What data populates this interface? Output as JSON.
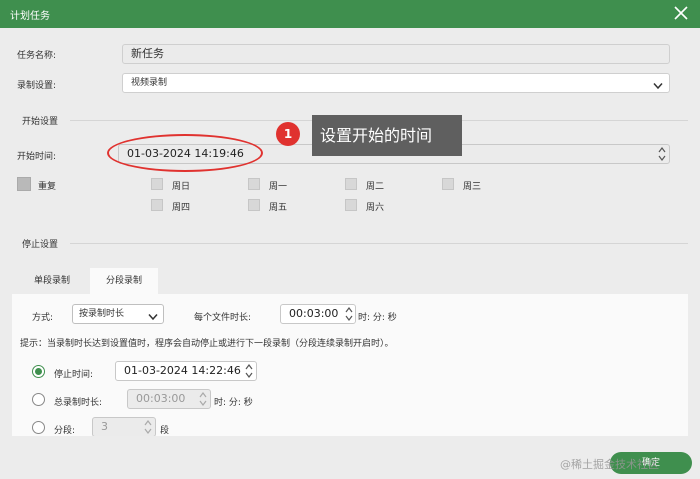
{
  "window": {
    "title": "计划任务"
  },
  "form": {
    "task_name_label": "任务名称:",
    "task_name_value": "新任务",
    "record_setting_label": "录制设置:",
    "record_setting_value": "视频录制"
  },
  "start": {
    "section_title": "开始设置",
    "start_time_label": "开始时间:",
    "start_time_value": "01-03-2024 14:19:46",
    "repeat_label": "重复",
    "days": [
      "周日",
      "周一",
      "周二",
      "周三",
      "周四",
      "周五",
      "周六"
    ]
  },
  "annotation": {
    "badge": "1",
    "tooltip": "设置开始的时间"
  },
  "stop": {
    "section_title": "停止设置",
    "tabs": [
      "单段录制",
      "分段录制"
    ],
    "mode_label": "方式:",
    "mode_value": "按录制时长",
    "file_duration_label": "每个文件时长:",
    "file_duration_value": "00:03:00",
    "hms_unit": "时: 分: 秒",
    "hint": "提示：当录制时长达到设置值时，程序会自动停止或进行下一段录制（分段连续录制开启时）。",
    "stop_time_label": "停止时间:",
    "stop_time_value": "01-03-2024 14:22:46",
    "total_duration_label": "总录制时长:",
    "total_duration_value": "00:03:00",
    "segments_label": "分段:",
    "segments_value": "3",
    "segments_unit": "段"
  },
  "footer": {
    "ok_label": "确定"
  },
  "watermark": "@稀土掘金技术社区",
  "colors": {
    "accent": "#3f8f4e",
    "highlight": "#e0322f"
  }
}
